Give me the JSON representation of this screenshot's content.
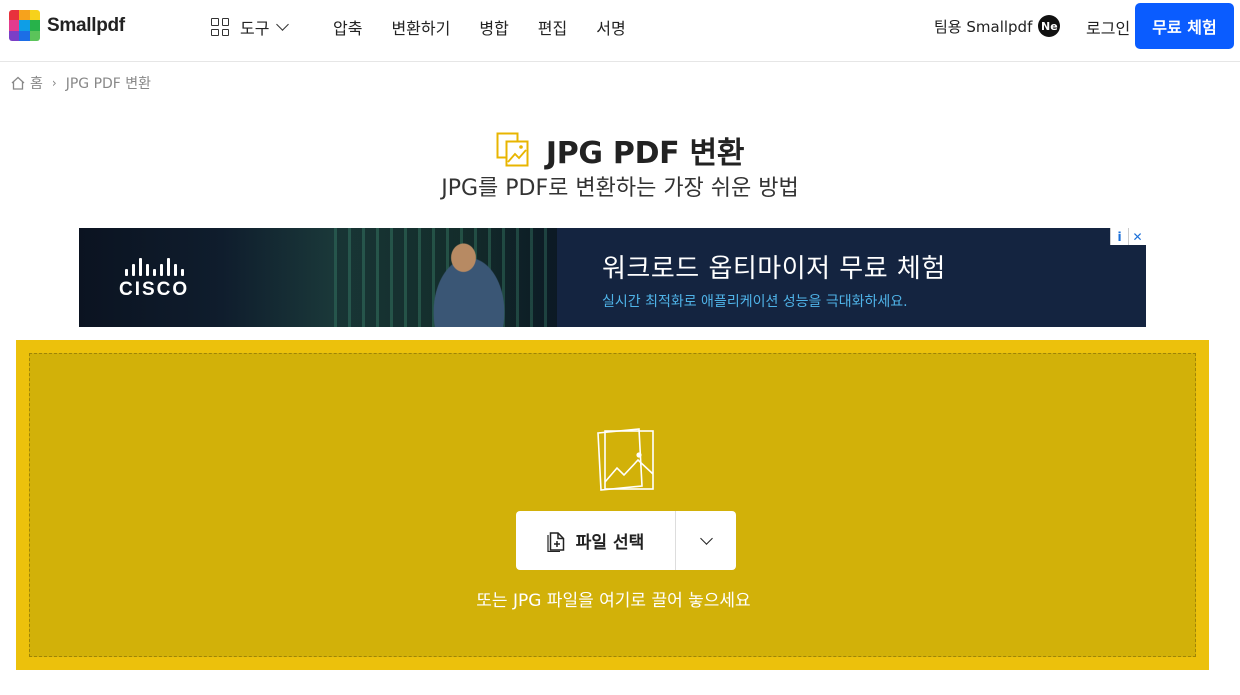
{
  "header": {
    "logo_text": "Smallpdf",
    "tools_label": "도구",
    "nav": [
      "압축",
      "변환하기",
      "병합",
      "편집",
      "서명"
    ],
    "team_label": "팀용 Smallpdf",
    "new_badge": "Ne",
    "login_label": "로그인",
    "cta_label": "무료 체험",
    "colors": {
      "cta": "#0a5cff"
    }
  },
  "breadcrumb": {
    "home": "홈",
    "separator": "›",
    "current": "JPG PDF 변환"
  },
  "page": {
    "title": "JPG PDF 변환",
    "subtitle": "JPG를 PDF로 변환하는 가장 쉬운 방법"
  },
  "ad": {
    "brand": "CISCO",
    "headline": "워크로드  옵티마이저 무료 체험",
    "subline": "실시간 최적화로 애플리케이션 성능을 극대화하세요.",
    "info_icon": "i",
    "close_icon": "✕"
  },
  "dropzone": {
    "button_label": "파일 선택",
    "hint": "또는 JPG 파일을 여기로 끌어 놓으세요",
    "colors": {
      "outer": "#ecc10c",
      "inner": "#d2b109"
    }
  }
}
